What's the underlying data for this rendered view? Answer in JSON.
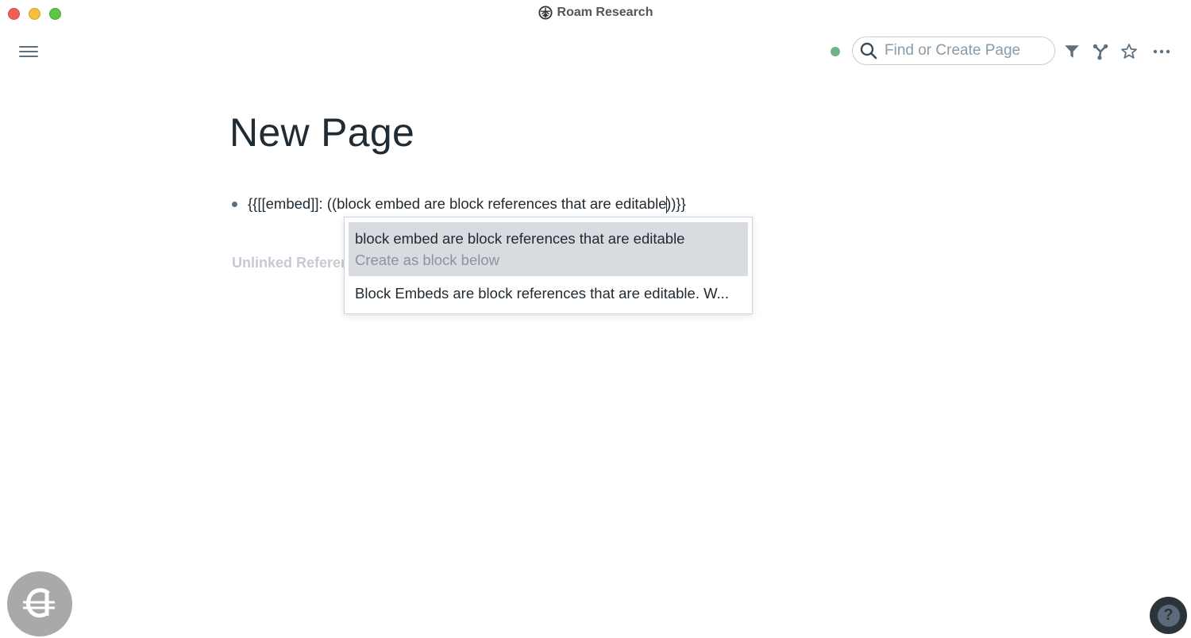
{
  "window": {
    "title": "Roam Research",
    "title_icon": "roam-logo-icon"
  },
  "topbar": {
    "menu_icon": "hamburger-menu-icon",
    "sync_status_color": "#6db38a",
    "search": {
      "placeholder": "Find or Create Page",
      "value": ""
    },
    "tools": [
      "filter-icon",
      "graph-icon",
      "star-icon",
      "more-icon"
    ]
  },
  "page": {
    "title": "New Page",
    "blocks": [
      {
        "text_before_caret": "{{[[embed]]: ((block embed are block references that are editable",
        "text_after_caret": "))}}"
      }
    ],
    "unlinked_references_label": "Unlinked References"
  },
  "autocomplete": {
    "options": [
      {
        "label": "block embed are block references that are editable",
        "sublabel": "Create as block below",
        "selected": true
      },
      {
        "label": "Block Embeds are block references that are editable. W...",
        "selected": false
      }
    ]
  },
  "floating": {
    "extension_badge_glyph": "₳",
    "help_glyph": "?"
  }
}
